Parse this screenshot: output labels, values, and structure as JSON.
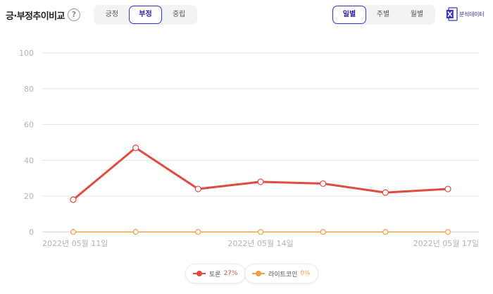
{
  "header": {
    "title": "긍·부정추이비교",
    "help": "?",
    "sentiment_tabs": [
      "긍정",
      "부정",
      "중립"
    ],
    "sentiment_active": 1,
    "period_tabs": [
      "일별",
      "주별",
      "월별"
    ],
    "period_active": 0,
    "excel_label": "분석데이터",
    "excel_icon": "excel-download-icon"
  },
  "colors": {
    "accent": "#3a33c9",
    "series1": "#e04b3f",
    "series2": "#f0a040",
    "grid": "#e6e6e6"
  },
  "chart_data": {
    "type": "line",
    "x": [
      "2022-05-11",
      "2022-05-12",
      "2022-05-13",
      "2022-05-14",
      "2022-05-15",
      "2022-05-16",
      "2022-05-17"
    ],
    "x_tick_labels": [
      "2022년 05월 11일",
      "2022년 05월 14일",
      "2022년 05월 17일"
    ],
    "x_tick_indices": [
      0,
      3,
      6
    ],
    "ylim": [
      0,
      100
    ],
    "yticks": [
      0,
      20,
      40,
      60,
      80,
      100
    ],
    "grid": true,
    "legend_position": "bottom-center",
    "series": [
      {
        "name": "토론",
        "percent": "27%",
        "color": "#e04b3f",
        "values": [
          18,
          47,
          24,
          28,
          27,
          22,
          24
        ]
      },
      {
        "name": "라이트코인",
        "percent": "0%",
        "color": "#f0a040",
        "values": [
          0,
          0,
          0,
          0,
          0,
          0,
          0
        ]
      }
    ]
  }
}
